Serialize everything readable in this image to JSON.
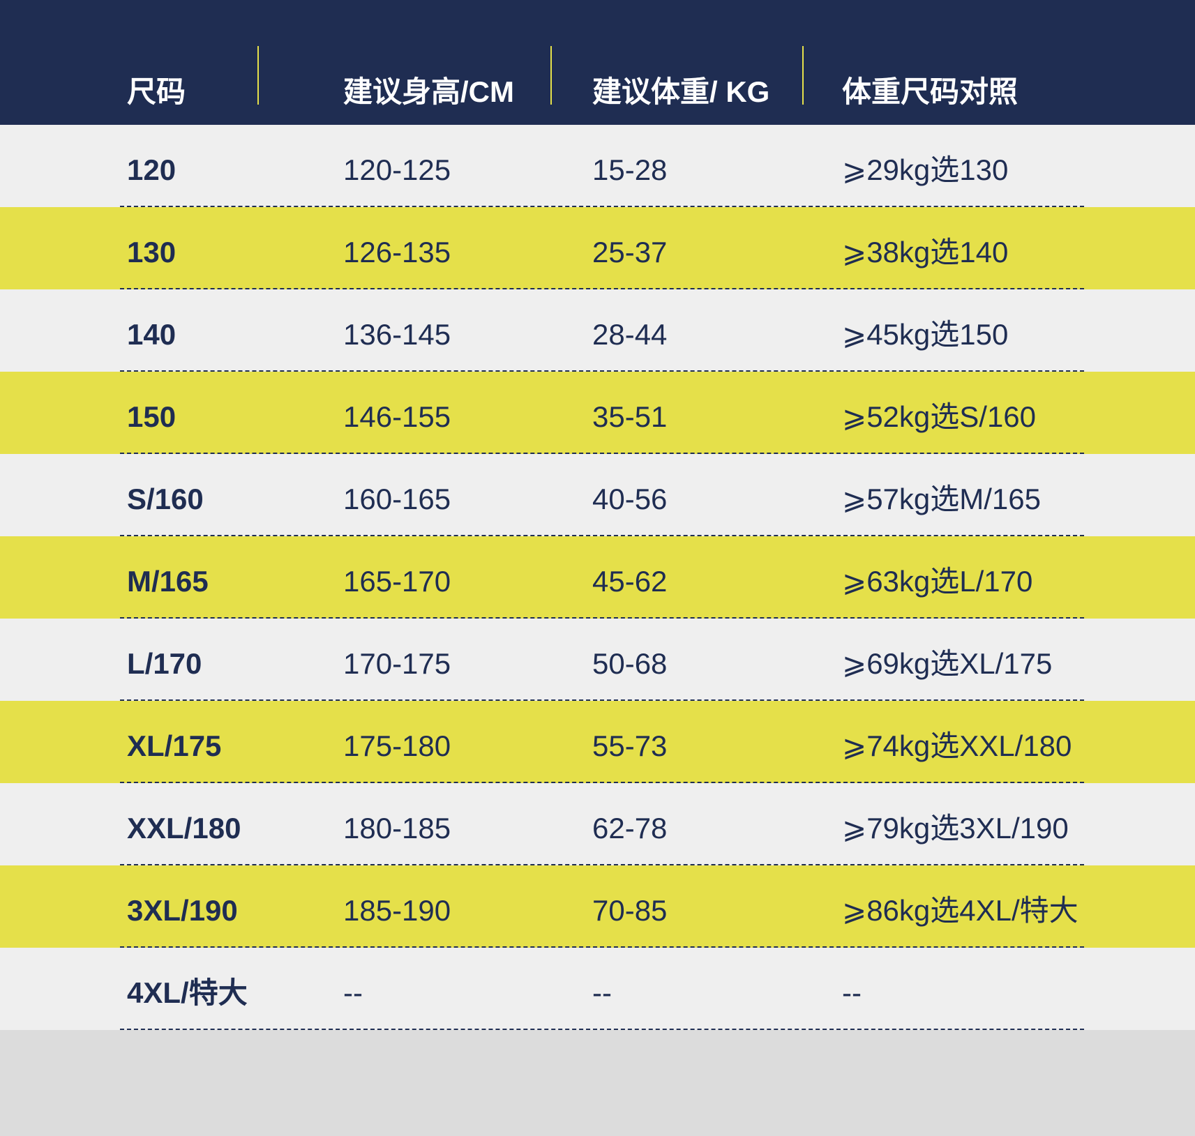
{
  "colors": {
    "header_bg": "#1f2d52",
    "accent_yellow": "#e5e04a",
    "row_light": "#efefef",
    "text_navy": "#1f2d52",
    "bottom_gray": "#dcdcdc"
  },
  "header": {
    "columns": [
      "尺码",
      "建议身高/CM",
      "建议体重/ KG",
      "体重尺码对照"
    ]
  },
  "rows": [
    {
      "size": "120",
      "height": "120-125",
      "weight": "15-28",
      "map": "⩾29kg选130"
    },
    {
      "size": "130",
      "height": "126-135",
      "weight": "25-37",
      "map": "⩾38kg选140"
    },
    {
      "size": "140",
      "height": "136-145",
      "weight": "28-44",
      "map": "⩾45kg选150"
    },
    {
      "size": "150",
      "height": "146-155",
      "weight": "35-51",
      "map": "⩾52kg选S/160"
    },
    {
      "size": "S/160",
      "height": "160-165",
      "weight": "40-56",
      "map": "⩾57kg选M/165"
    },
    {
      "size": "M/165",
      "height": "165-170",
      "weight": "45-62",
      "map": "⩾63kg选L/170"
    },
    {
      "size": "L/170",
      "height": "170-175",
      "weight": "50-68",
      "map": "⩾69kg选XL/175"
    },
    {
      "size": "XL/175",
      "height": "175-180",
      "weight": "55-73",
      "map": "⩾74kg选XXL/180"
    },
    {
      "size": "XXL/180",
      "height": "180-185",
      "weight": "62-78",
      "map": "⩾79kg选3XL/190"
    },
    {
      "size": "3XL/190",
      "height": "185-190",
      "weight": "70-85",
      "map": "⩾86kg选4XL/特大"
    },
    {
      "size": "4XL/特大",
      "height": "--",
      "weight": "--",
      "map": "--"
    }
  ]
}
